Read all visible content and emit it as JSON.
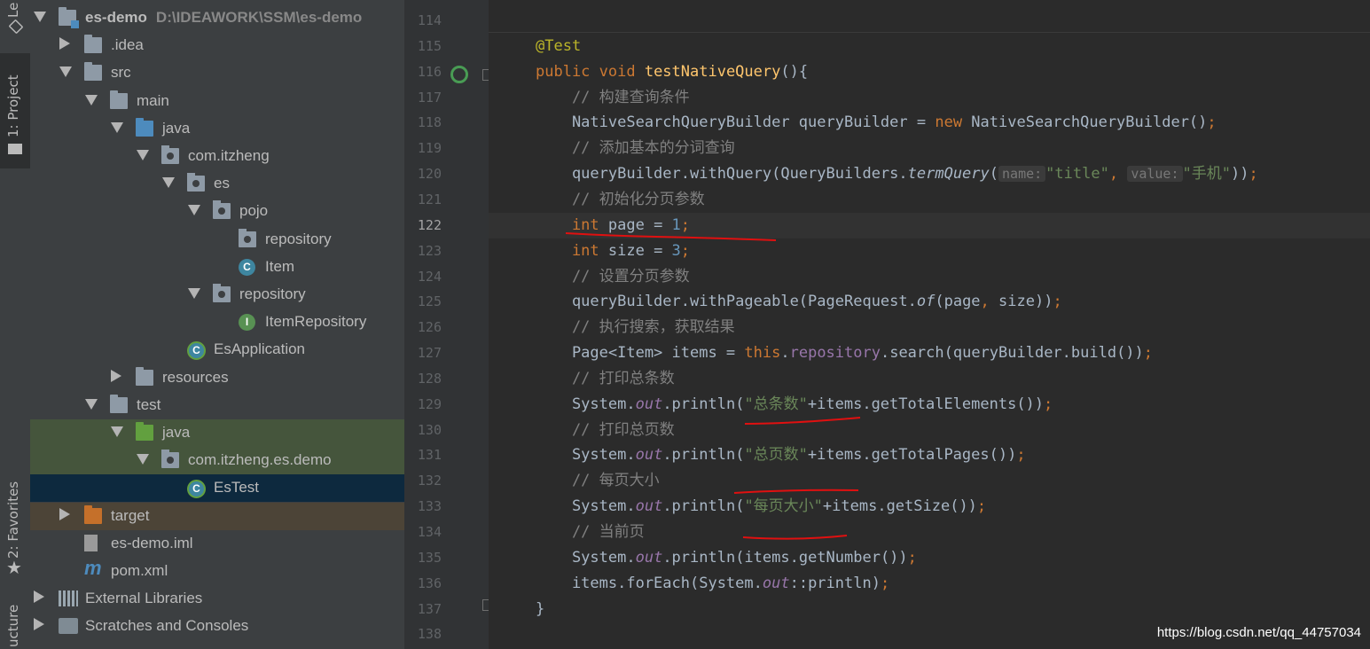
{
  "toolstrip": {
    "tab_top": "Le",
    "tab_project": "1: Project",
    "tab_favorites": "2: Favorites",
    "tab_structure": "ucture"
  },
  "tree": [
    {
      "indent": 0,
      "arrow": "down",
      "icon": "module",
      "label": "es-demo",
      "path": "D:\\IDEAWORK\\SSM\\es-demo"
    },
    {
      "indent": 1,
      "arrow": "right",
      "icon": "folder",
      "label": ".idea"
    },
    {
      "indent": 1,
      "arrow": "down",
      "icon": "folder",
      "label": "src"
    },
    {
      "indent": 2,
      "arrow": "down",
      "icon": "folder",
      "label": "main"
    },
    {
      "indent": 3,
      "arrow": "down",
      "icon": "folder-blue",
      "label": "java"
    },
    {
      "indent": 4,
      "arrow": "down",
      "icon": "package",
      "label": "com.itzheng"
    },
    {
      "indent": 5,
      "arrow": "down",
      "icon": "package",
      "label": "es"
    },
    {
      "indent": 6,
      "arrow": "down",
      "icon": "package",
      "label": "pojo"
    },
    {
      "indent": 7,
      "arrow": "",
      "icon": "package",
      "label": "repository"
    },
    {
      "indent": 7,
      "arrow": "",
      "icon": "class",
      "label": "Item"
    },
    {
      "indent": 6,
      "arrow": "down",
      "icon": "package",
      "label": "repository"
    },
    {
      "indent": 7,
      "arrow": "",
      "icon": "interface",
      "label": "ItemRepository"
    },
    {
      "indent": 5,
      "arrow": "",
      "icon": "spring-class",
      "label": "EsApplication"
    },
    {
      "indent": 3,
      "arrow": "right",
      "icon": "folder-resources",
      "label": "resources"
    },
    {
      "indent": 2,
      "arrow": "down",
      "icon": "folder",
      "label": "test"
    },
    {
      "indent": 3,
      "arrow": "down",
      "icon": "folder-green",
      "label": "java",
      "hl": "green"
    },
    {
      "indent": 4,
      "arrow": "down",
      "icon": "package",
      "label": "com.itzheng.es.demo",
      "hl": "green"
    },
    {
      "indent": 5,
      "arrow": "",
      "icon": "spring-class",
      "label": "EsTest",
      "hl": "selected"
    },
    {
      "indent": 1,
      "arrow": "right",
      "icon": "folder-orange",
      "label": "target",
      "hl": "brown"
    },
    {
      "indent": 1,
      "arrow": "",
      "icon": "file-iml",
      "label": "es-demo.iml"
    },
    {
      "indent": 1,
      "arrow": "",
      "icon": "maven",
      "label": "pom.xml"
    },
    {
      "indent": 0,
      "arrow": "right",
      "icon": "libraries",
      "label": "External Libraries"
    },
    {
      "indent": 0,
      "arrow": "right",
      "icon": "scratches",
      "label": "Scratches and Consoles"
    }
  ],
  "editor": {
    "current_line": 122,
    "lines": [
      {
        "n": 114,
        "t": []
      },
      {
        "n": 115,
        "t": [
          [
            "an",
            "@Test"
          ]
        ]
      },
      {
        "n": 116,
        "t": [
          [
            "kw",
            "public void "
          ],
          [
            "fn",
            "testNativeQuery"
          ],
          [
            "",
            "(){"
          ]
        ]
      },
      {
        "n": 117,
        "t": [
          [
            "cm",
            "    // 构建查询条件"
          ]
        ]
      },
      {
        "n": 118,
        "t": [
          [
            "",
            "    NativeSearchQueryBuilder queryBuilder = "
          ],
          [
            "kw",
            "new "
          ],
          [
            "",
            "NativeSearchQueryBuilder()"
          ],
          [
            "kw",
            ";"
          ]
        ]
      },
      {
        "n": 119,
        "t": [
          [
            "cm",
            "    // 添加基本的分词查询"
          ]
        ]
      },
      {
        "n": 120,
        "t": [
          [
            "",
            "    queryBuilder.withQuery(QueryBuilders."
          ],
          [
            "it",
            "termQuery"
          ],
          [
            "",
            "("
          ],
          [
            "hint",
            "name:"
          ],
          [
            "str",
            "\"title\""
          ],
          [
            "kw",
            ", "
          ],
          [
            "hint",
            "value:"
          ],
          [
            "str",
            "\"手机\""
          ],
          [
            "",
            "))"
          ],
          [
            "kw",
            ";"
          ]
        ]
      },
      {
        "n": 121,
        "t": [
          [
            "cm",
            "    // 初始化分页参数"
          ]
        ]
      },
      {
        "n": 122,
        "t": [
          [
            "kw",
            "    int "
          ],
          [
            "",
            "page = "
          ],
          [
            "num",
            "1"
          ],
          [
            "kw",
            ";"
          ]
        ]
      },
      {
        "n": 123,
        "t": [
          [
            "kw",
            "    int "
          ],
          [
            "",
            "size = "
          ],
          [
            "num",
            "3"
          ],
          [
            "kw",
            ";"
          ]
        ]
      },
      {
        "n": 124,
        "t": [
          [
            "cm",
            "    // 设置分页参数"
          ]
        ]
      },
      {
        "n": 125,
        "t": [
          [
            "",
            "    queryBuilder.withPageable(PageRequest."
          ],
          [
            "it",
            "of"
          ],
          [
            "",
            "(page"
          ],
          [
            "kw",
            ", "
          ],
          [
            "",
            "size))"
          ],
          [
            "kw",
            ";"
          ]
        ]
      },
      {
        "n": 126,
        "t": [
          [
            "cm",
            "    // 执行搜索，获取结果"
          ]
        ]
      },
      {
        "n": 127,
        "t": [
          [
            "",
            "    Page<Item> items = "
          ],
          [
            "kw",
            "this"
          ],
          [
            "",
            "."
          ],
          [
            "fld",
            "repository"
          ],
          [
            "",
            ".search(queryBuilder.build())"
          ],
          [
            "kw",
            ";"
          ]
        ]
      },
      {
        "n": 128,
        "t": [
          [
            "cm",
            "    // 打印总条数"
          ]
        ]
      },
      {
        "n": 129,
        "t": [
          [
            "",
            "    System."
          ],
          [
            "st",
            "out"
          ],
          [
            "",
            ".println("
          ],
          [
            "str",
            "\"总条数\""
          ],
          [
            "",
            "+items.getTotalElements())"
          ],
          [
            "kw",
            ";"
          ]
        ]
      },
      {
        "n": 130,
        "t": [
          [
            "cm",
            "    // 打印总页数"
          ]
        ]
      },
      {
        "n": 131,
        "t": [
          [
            "",
            "    System."
          ],
          [
            "st",
            "out"
          ],
          [
            "",
            ".println("
          ],
          [
            "str",
            "\"总页数\""
          ],
          [
            "",
            "+items.getTotalPages())"
          ],
          [
            "kw",
            ";"
          ]
        ]
      },
      {
        "n": 132,
        "t": [
          [
            "cm",
            "    // 每页大小"
          ]
        ]
      },
      {
        "n": 133,
        "t": [
          [
            "",
            "    System."
          ],
          [
            "st",
            "out"
          ],
          [
            "",
            ".println("
          ],
          [
            "str",
            "\"每页大小\""
          ],
          [
            "",
            "+items.getSize())"
          ],
          [
            "kw",
            ";"
          ]
        ]
      },
      {
        "n": 134,
        "t": [
          [
            "cm",
            "    // 当前页"
          ]
        ]
      },
      {
        "n": 135,
        "t": [
          [
            "",
            "    System."
          ],
          [
            "st",
            "out"
          ],
          [
            "",
            ".println(items.getNumber())"
          ],
          [
            "kw",
            ";"
          ]
        ]
      },
      {
        "n": 136,
        "t": [
          [
            "",
            "    items.forEach(System."
          ],
          [
            "st",
            "out"
          ],
          [
            "",
            "::println)"
          ],
          [
            "kw",
            ";"
          ]
        ]
      },
      {
        "n": 137,
        "t": [
          [
            "",
            "}"
          ]
        ]
      },
      {
        "n": 138,
        "t": []
      }
    ]
  },
  "watermark": "https://blog.csdn.net/qq_44757034",
  "colors": {
    "keyword": "#cc7832",
    "string": "#6a8759",
    "comment": "#808080",
    "annotation": "#bbb529",
    "underline": "#e01010",
    "selected": "#0d293e"
  }
}
